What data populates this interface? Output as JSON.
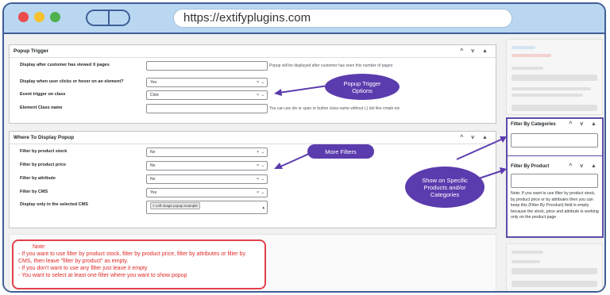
{
  "browser": {
    "url": "https://extifyplugins.com"
  },
  "popup_trigger": {
    "title": "Popup Trigger",
    "controls": "^ v ▲",
    "rows": [
      {
        "label": "Display after customer has viewed X pages",
        "value": "",
        "help": "Popup will be displayed after customer has seen this number of pages"
      },
      {
        "label": "Display when user clicks or hover on an element?",
        "value": "Yes"
      },
      {
        "label": "Event trigger on class",
        "value": "Click"
      },
      {
        "label": "Element Class name",
        "value": "",
        "help": "You can use div or span or button class name without (.) dot like cmale etc"
      }
    ]
  },
  "where_to_display": {
    "title": "Where To Display Popup",
    "controls": "^ v ▲",
    "rows": [
      {
        "label": "Filter by product stock",
        "value": "No"
      },
      {
        "label": "Filter by product price",
        "value": "No"
      },
      {
        "label": "Filter by attribute",
        "value": "No"
      },
      {
        "label": "Filter by CMS",
        "value": "Yes"
      },
      {
        "label": "Display only in the selected CMS",
        "tag": "× Left image popup example"
      }
    ]
  },
  "sidebar": {
    "filter_categories": {
      "title": "Filter By Categories",
      "controls": "^ v ▲"
    },
    "filter_product": {
      "title": "Filter By Product",
      "controls": "^ v ▲",
      "note": "Note: If you want to use filter by product stock, by product price or by attributes then you can keep this (Filter By Procduct) field is empty because the stock, price and attribute is working only on the product page"
    }
  },
  "callouts": {
    "trigger": "Popup Trigger Options",
    "filters": "More Filters",
    "specific": "Show on Specific Products and/or Categories"
  },
  "note": {
    "title": "Note:",
    "lines": [
      "- If you want to use filter by product stock, filter by product price, filter by attributes or filter by CMS, then leave \"filter by product\" as empty.",
      "- If you don't want to use any filter just leave it empty",
      "- You want to select at least one filter where you want to show popup"
    ]
  },
  "colors": {
    "accent": "#5b3cae",
    "frame": "#3e5e96",
    "note": "#e02626"
  }
}
